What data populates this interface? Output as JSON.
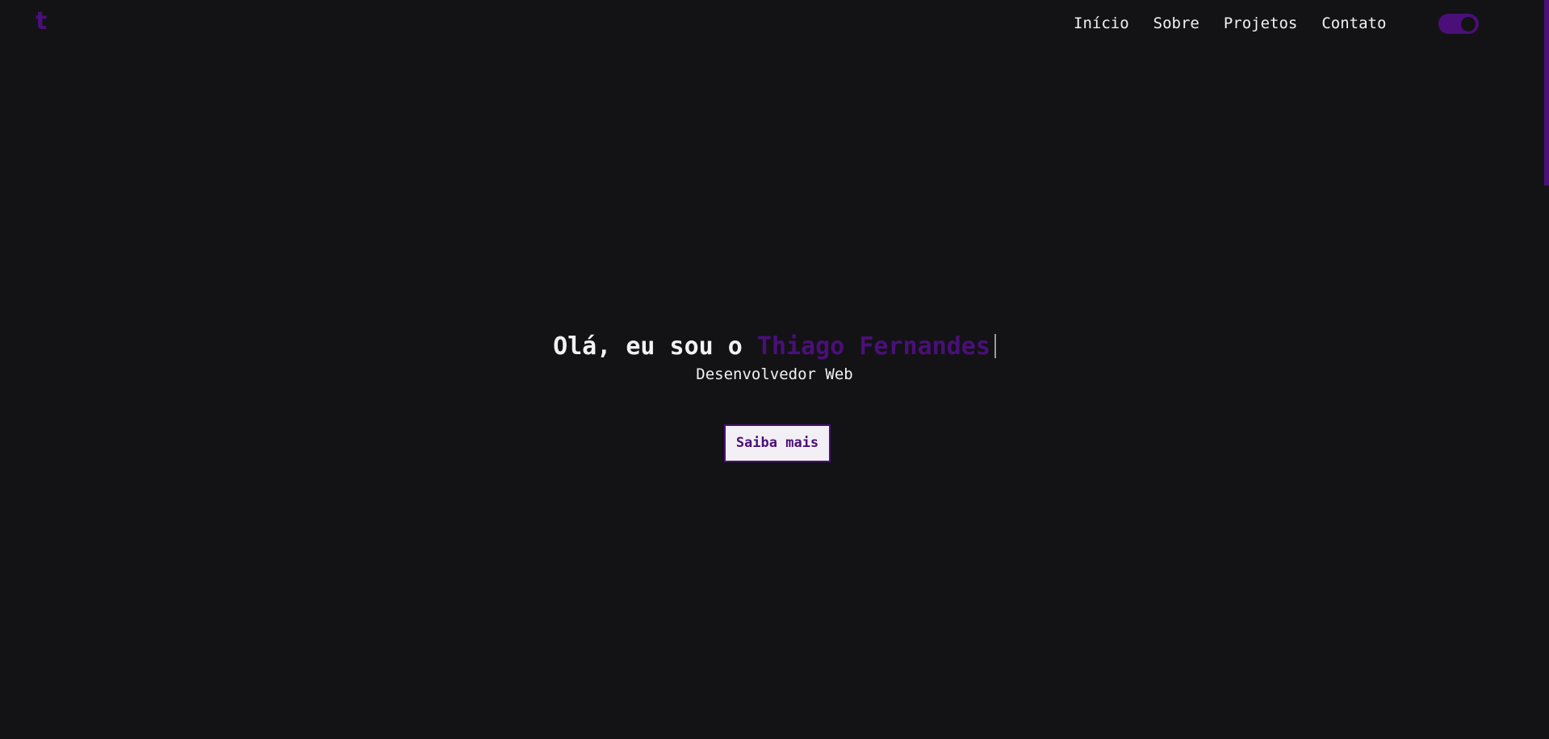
{
  "header": {
    "logo_text": "t",
    "nav": [
      {
        "label": "Início"
      },
      {
        "label": "Sobre"
      },
      {
        "label": "Projetos"
      },
      {
        "label": "Contato"
      }
    ],
    "theme_toggle": {
      "state": "on",
      "icon": "toggle-switch-icon"
    }
  },
  "hero": {
    "greeting": "Olá, eu sou o ",
    "name": "Thiago Fernandes",
    "subtitle": "Desenvolvedor Web",
    "cta_label": "Saiba mais"
  },
  "colors": {
    "background": "#131316",
    "accent": "#4a0f78",
    "text": "#f2f2f4",
    "button_bg": "#f3f0f5"
  }
}
